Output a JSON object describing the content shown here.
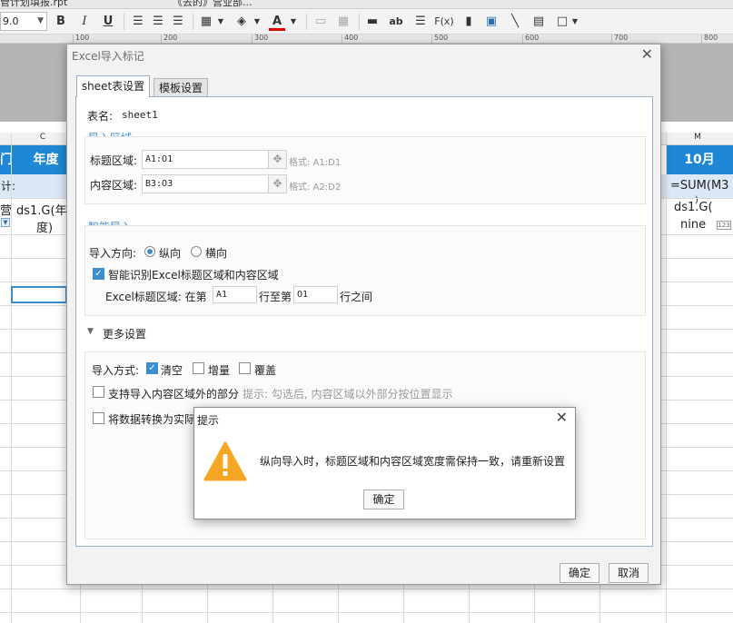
{
  "tabs": {
    "left_text": "管计划填报.rpt",
    "right_text": "《去的》营业部..."
  },
  "toolbar": {
    "font_size": "9.0",
    "bold": "B",
    "italic": "I",
    "underline": "U",
    "text_label": "ab",
    "formula_label": "F(x)",
    "font_color_label": "A"
  },
  "ruler": {
    "ticks": [
      "100",
      "200",
      "300",
      "400",
      "500",
      "600",
      "700",
      "800"
    ]
  },
  "sheet": {
    "col_c": "C",
    "col_m": "M",
    "hdr_left": "门",
    "hdr_year": "年度",
    "hdr_month": "10月",
    "row_left": "计:",
    "row_sum": "=SUM(M3",
    "row_sum2": ")",
    "cell_left": "营",
    "cell_ds1_line1": "ds1.G(年",
    "cell_ds1_line2": "度)",
    "cell_ds2_line1": "ds1.G(",
    "cell_ds2_line2": "nine"
  },
  "dialog": {
    "title": "Excel导入标记",
    "tab_sheet": "sheet表设置",
    "tab_template": "模板设置",
    "sheet_name_label": "表名:",
    "sheet_name_value": "sheet1",
    "import_area_title": "导入区域",
    "title_area_label": "标题区域:",
    "title_area_value": "A1:O1",
    "title_area_hint": "格式: A1:D1",
    "content_area_label": "内容区域:",
    "content_area_value": "B3:O3",
    "content_area_hint": "格式: A2:D2",
    "smart_import_title": "智能导入",
    "direction_label": "导入方向:",
    "direction_vertical": "纵向",
    "direction_horizontal": "横向",
    "smart_detect_label": "智能识别Excel标题区域和内容区域",
    "excel_title_area_label": "Excel标题区域: 在第",
    "row_from_value": "A1",
    "row_to_label": "行至第",
    "row_to_value": "O1",
    "row_between_label": "行之间",
    "more_settings_title": "更多设置",
    "import_mode_label": "导入方式:",
    "mode_clear": "清空",
    "mode_increment": "增量",
    "mode_overwrite": "覆盖",
    "support_outside_label": "支持导入内容区域外的部分",
    "support_outside_hint": "提示: 勾选后, 内容区域以外部分按位置显示",
    "convert_label": "将数据转换为实际",
    "ok_button": "确定",
    "cancel_button": "取消"
  },
  "alert": {
    "title": "提示",
    "message": "纵向导入时，标题区域和内容区域宽度需保持一致，请重新设置",
    "ok_button": "确定"
  },
  "colors": {
    "accent": "#3b8ed0",
    "header_band": "#1e88d6",
    "warning": "#f5a623"
  }
}
